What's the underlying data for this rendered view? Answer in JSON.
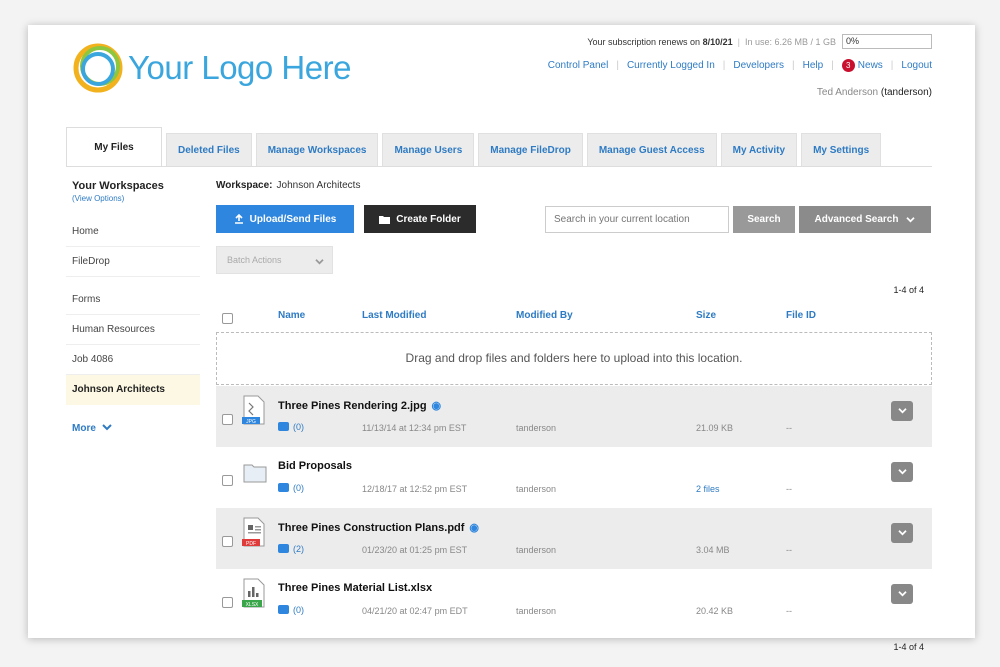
{
  "brand": {
    "logo_text": "Your Logo Here",
    "accent": "#2e86de",
    "link_color": "#2e7bc4"
  },
  "header": {
    "renew_prefix": "Your subscription renews on",
    "renew_date": "8/10/21",
    "in_use": "In use: 6.26 MB / 1 GB",
    "usage_value": "0%",
    "links": {
      "control_panel": "Control Panel",
      "logged_in": "Currently Logged In",
      "developers": "Developers",
      "help": "Help",
      "news_count": "3",
      "news": "News",
      "logout": "Logout"
    },
    "user_name": "Ted Anderson",
    "user_login": "(tanderson)"
  },
  "tabs": [
    {
      "label": "My Files"
    },
    {
      "label": "Deleted Files"
    },
    {
      "label": "Manage Workspaces"
    },
    {
      "label": "Manage Users"
    },
    {
      "label": "Manage FileDrop"
    },
    {
      "label": "Manage Guest Access"
    },
    {
      "label": "My Activity"
    },
    {
      "label": "My Settings"
    }
  ],
  "sidebar": {
    "title": "Your Workspaces",
    "view_options": "(View Options)",
    "items": [
      {
        "label": "Home"
      },
      {
        "label": "FileDrop"
      },
      {
        "label": "Forms"
      },
      {
        "label": "Human Resources"
      },
      {
        "label": "Job 4086"
      },
      {
        "label": "Johnson Architects"
      }
    ],
    "more": "More"
  },
  "main": {
    "workspace_label": "Workspace:",
    "workspace_name": "Johnson Architects",
    "upload_label": "Upload/Send Files",
    "create_label": "Create Folder",
    "search_placeholder": "Search in your current location",
    "search_label": "Search",
    "advanced_label": "Advanced Search",
    "batch_label": "Batch Actions",
    "count_label": "1-4 of 4",
    "columns": {
      "name": "Name",
      "modified": "Last Modified",
      "by": "Modified By",
      "size": "Size",
      "fileid": "File ID"
    },
    "dropzone": "Drag and drop files and folders here to upload into this location.",
    "rows": [
      {
        "name": "Three Pines Rendering 2.jpg",
        "type": "JPG",
        "comments": "(0)",
        "modified": "11/13/14 at 12:34 pm EST",
        "by": "tanderson",
        "size": "21.09 KB",
        "fileid": "--"
      },
      {
        "name": "Bid Proposals",
        "type": "folder",
        "comments": "(0)",
        "modified": "12/18/17 at 12:52 pm EST",
        "by": "tanderson",
        "size": "2 files",
        "fileid": "--"
      },
      {
        "name": "Three Pines Construction Plans.pdf",
        "type": "PDF",
        "comments": "(2)",
        "modified": "01/23/20 at 01:25 pm EST",
        "by": "tanderson",
        "size": "3.04 MB",
        "fileid": "--"
      },
      {
        "name": "Three Pines Material List.xlsx",
        "type": "XLSX",
        "comments": "(0)",
        "modified": "04/21/20 at 02:47 pm EDT",
        "by": "tanderson",
        "size": "20.42 KB",
        "fileid": "--"
      }
    ]
  }
}
